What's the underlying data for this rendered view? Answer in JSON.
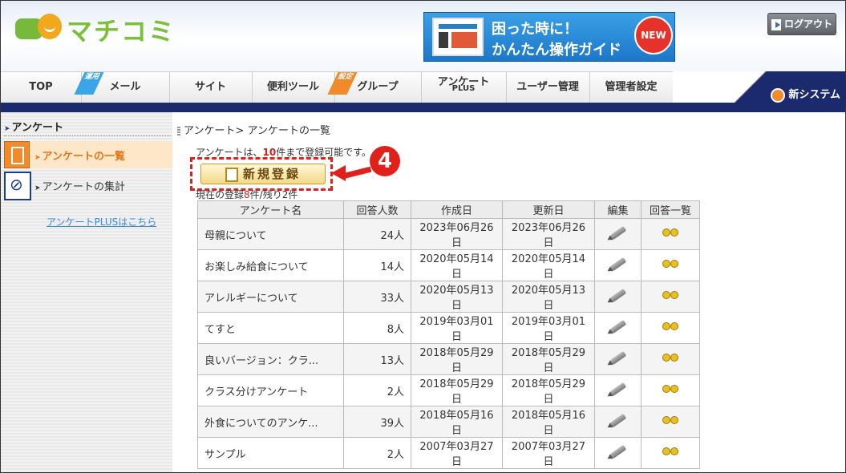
{
  "app": {
    "logo_text": "マチコミ"
  },
  "banner": {
    "line1": "困った時に！",
    "line2": "かんたん操作ガイド",
    "badge": "NEW"
  },
  "header": {
    "logout_label": "ログアウト",
    "new_system_label": "新システム"
  },
  "nav": {
    "tabs": [
      {
        "label": "TOP"
      },
      {
        "label": "メール",
        "tag": "運用"
      },
      {
        "label": "サイト"
      },
      {
        "label": "便利ツール"
      },
      {
        "label": "グループ",
        "tag": "設定"
      },
      {
        "label": "アンケート",
        "sub": "PLUS"
      },
      {
        "label": "ユーザー管理"
      },
      {
        "label": "管理者設定"
      }
    ]
  },
  "sidebar": {
    "title": "アンケート",
    "items": [
      {
        "label": "アンケートの一覧",
        "active": true
      },
      {
        "label": "アンケートの集計",
        "active": false
      }
    ],
    "plus_link": "アンケートPLUSはこちら"
  },
  "main": {
    "breadcrumb": "アンケート> アンケートの一覧",
    "notice_pre": "アンケートは、",
    "notice_num": "10",
    "notice_post": "件まで登録可能です。",
    "new_button": "新規登録",
    "step_badge": "4",
    "count_pre": "現在の登録",
    "count_num": "8",
    "count_post": "件/残り2件"
  },
  "table": {
    "headers": [
      "アンケート名",
      "回答人数",
      "作成日",
      "更新日",
      "編集",
      "回答一覧"
    ],
    "rows": [
      {
        "name": "母親について",
        "count": "24人",
        "created": "2023年06月26日",
        "updated": "2023年06月26日"
      },
      {
        "name": "お楽しみ給食について",
        "count": "14人",
        "created": "2020年05月14日",
        "updated": "2020年05月14日"
      },
      {
        "name": "アレルギーについて",
        "count": "33人",
        "created": "2020年05月13日",
        "updated": "2020年05月13日"
      },
      {
        "name": "てすと",
        "count": "8人",
        "created": "2019年03月01日",
        "updated": "2019年03月01日"
      },
      {
        "name": "良いバージョン：クラ...",
        "count": "13人",
        "created": "2018年05月29日",
        "updated": "2018年05月29日"
      },
      {
        "name": "クラス分けアンケート",
        "count": "2人",
        "created": "2018年05月29日",
        "updated": "2018年05月29日"
      },
      {
        "name": "外食についてのアンケ...",
        "count": "39人",
        "created": "2018年05月16日",
        "updated": "2018年05月16日"
      },
      {
        "name": "サンプル",
        "count": "2人",
        "created": "2007年03月27日",
        "updated": "2007年03月27日"
      }
    ]
  },
  "colors": {
    "accent_orange": "#f08a2a",
    "nav_navy": "#1a2a6c",
    "highlight_red": "#e0201a",
    "link_blue": "#3a8ad8"
  }
}
